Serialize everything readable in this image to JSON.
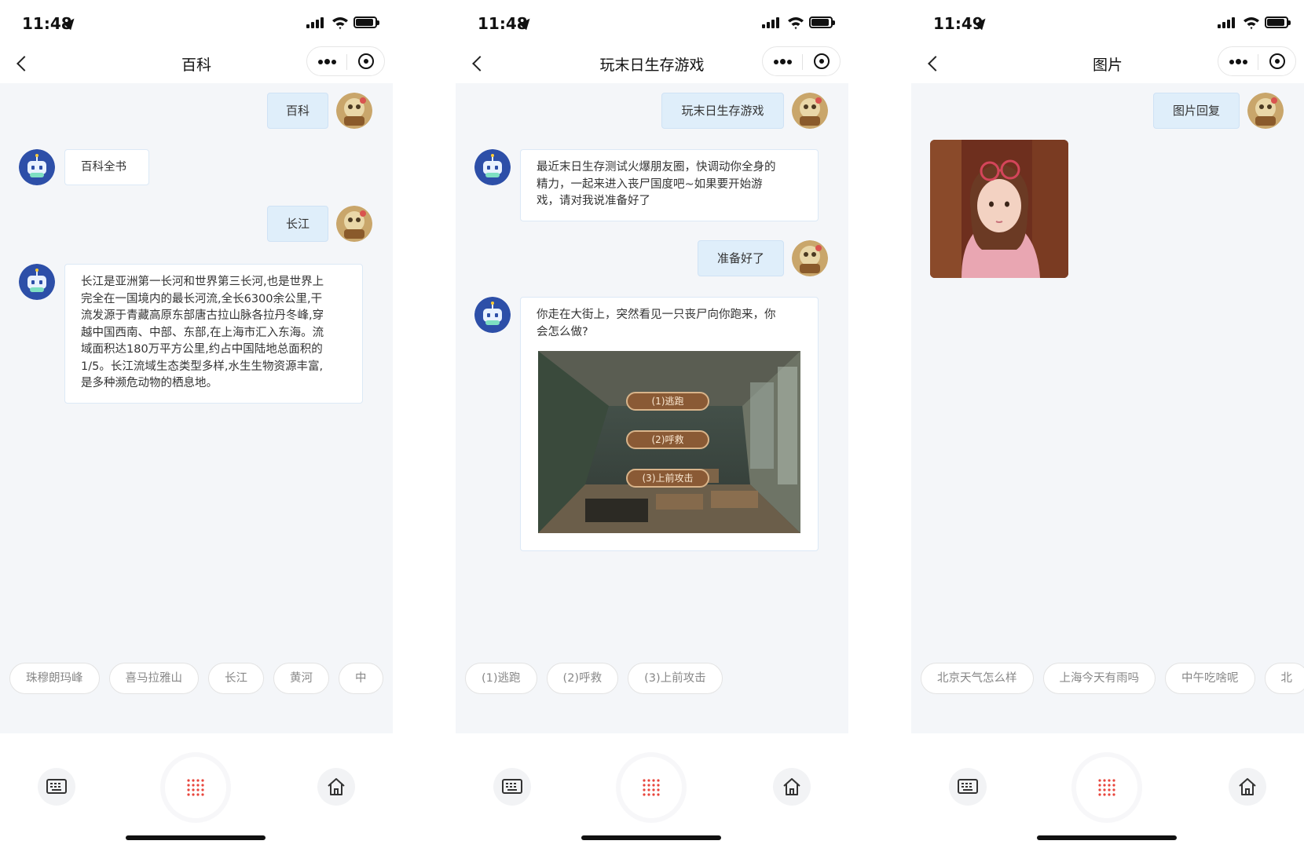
{
  "status_times": [
    "11:48",
    "11:48",
    "11:49"
  ],
  "screens": [
    {
      "title": "百科",
      "messages": {
        "user_1": "百科",
        "bot_1": "百科全书",
        "user_2": "长江",
        "bot_2_lines": [
          "长江是亚洲第一长河和世界第三长河,也是世界上",
          "完全在一国境内的最长河流,全长6300余公里,干",
          "流发源于青藏高原东部唐古拉山脉各拉丹冬峰,穿",
          "越中国西南、中部、东部,在上海市汇入东海。流",
          "域面积达180万平方公里,约占中国陆地总面积的",
          "1/5。长江流域生态类型多样,水生生物资源丰富,",
          "是多种濒危动物的栖息地。"
        ]
      },
      "suggestions": [
        "珠穆朗玛峰",
        "喜马拉雅山",
        "长江",
        "黄河",
        "中"
      ]
    },
    {
      "title": "玩末日生存游戏",
      "messages": {
        "user_1": "玩末日生存游戏",
        "bot_1_lines": [
          "最近末日生存测试火爆朋友圈，快调动你全身的",
          "精力，一起来进入丧尸国度吧~如果要开始游",
          "戏，请对我说准备好了"
        ],
        "user_2": "准备好了",
        "bot_2_lines": [
          "你走在大街上，突然看见一只丧尸向你跑来，你",
          "会怎么做?"
        ],
        "image_options": [
          "(1)逃跑",
          "(2)呼救",
          "(3)上前攻击"
        ]
      },
      "suggestions": [
        "(1)逃跑",
        "(2)呼救",
        "(3)上前攻击"
      ]
    },
    {
      "title": "图片",
      "messages": {
        "user_1": "图片回复"
      },
      "suggestions": [
        "北京天气怎么样",
        "上海今天有雨吗",
        "中午吃啥呢",
        "北"
      ]
    }
  ],
  "icons": {
    "back": "chevron-left-icon",
    "more": "more-dots-icon",
    "close": "target-close-icon",
    "keyboard": "keyboard-icon",
    "voice": "voice-dots-icon",
    "home": "home-icon"
  },
  "colors": {
    "user_bubble": "#dfeefa",
    "bot_bubble": "#ffffff",
    "voice_accent": "#e8453c",
    "chat_background": "#f4f6f9"
  }
}
